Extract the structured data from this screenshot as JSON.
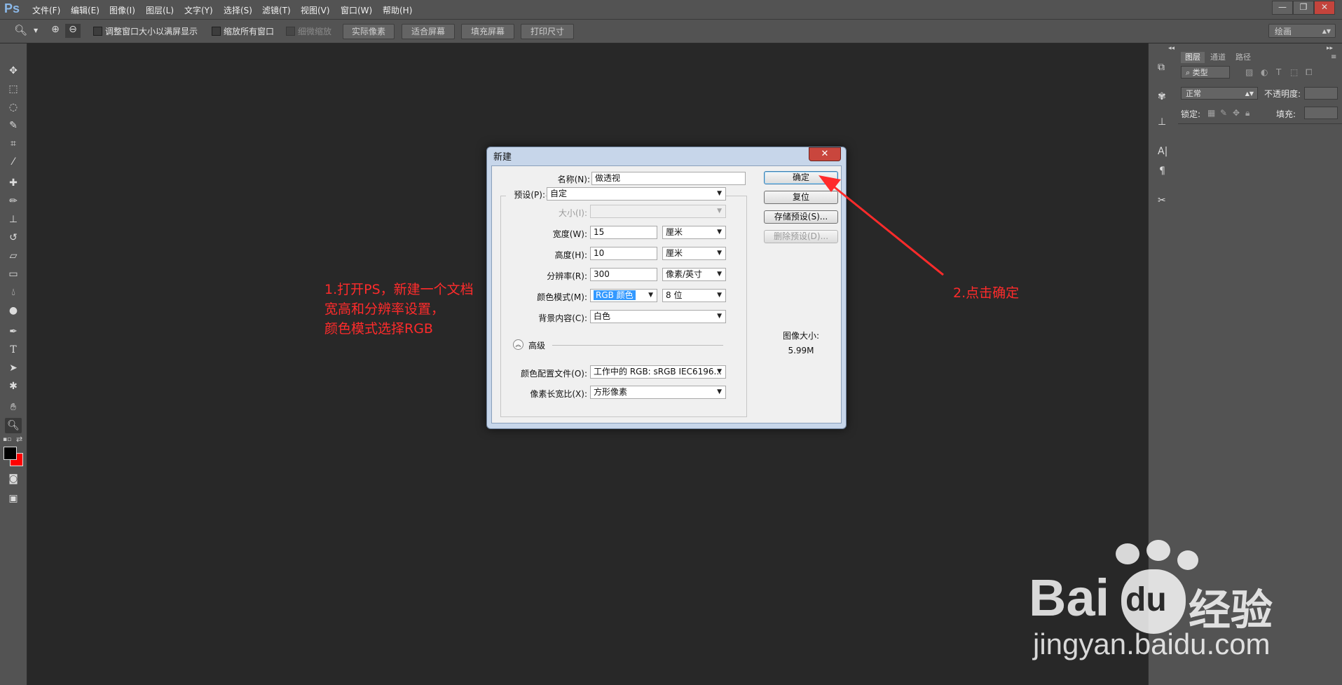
{
  "app": {
    "logo": "Ps"
  },
  "menu": [
    "文件(F)",
    "编辑(E)",
    "图像(I)",
    "图层(L)",
    "文字(Y)",
    "选择(S)",
    "滤镜(T)",
    "视图(V)",
    "窗口(W)",
    "帮助(H)"
  ],
  "window_controls": {
    "minimize": "—",
    "restore": "❐",
    "close": "✕"
  },
  "options_bar": {
    "zoom_icon": "zoom-icon",
    "checkbox_resize": "调整窗口大小以满屏显示",
    "checkbox_zoom_all": "缩放所有窗口",
    "checkbox_scrubby": "细微缩放",
    "btn_actual": "实际像素",
    "btn_fit": "适合屏幕",
    "btn_fill": "填充屏幕",
    "btn_print": "打印尺寸",
    "workspace": "绘画"
  },
  "tools": [
    "move-icon",
    "marquee-icon",
    "lasso-icon",
    "quick-select-icon",
    "crop-icon",
    "eyedropper-icon",
    "healing-icon",
    "brush-icon",
    "stamp-icon",
    "history-brush-icon",
    "eraser-icon",
    "gradient-icon",
    "blur-icon",
    "dodge-icon",
    "pen-icon",
    "type-icon",
    "path-select-icon",
    "shape-icon",
    "hand-icon",
    "zoom-icon"
  ],
  "colors": {
    "foreground": "#000000",
    "background": "#ff0000",
    "accent": "#ff2b2b"
  },
  "layers_panel": {
    "tabs": [
      "图层",
      "通道",
      "路径"
    ],
    "filter": "类型",
    "blend_mode": "正常",
    "opacity_label": "不透明度:",
    "lock_label": "锁定:",
    "fill_label": "填充:"
  },
  "dialog": {
    "title": "新建",
    "name_label": "名称(N):",
    "name_value": "做透视",
    "preset_label": "预设(P):",
    "preset_value": "自定",
    "size_label": "大小(I):",
    "width_label": "宽度(W):",
    "width_value": "15",
    "width_unit": "厘米",
    "height_label": "高度(H):",
    "height_value": "10",
    "height_unit": "厘米",
    "resolution_label": "分辨率(R):",
    "resolution_value": "300",
    "resolution_unit": "像素/英寸",
    "color_mode_label": "颜色模式(M):",
    "color_mode_value": "RGB 颜色",
    "bit_depth": "8 位",
    "bg_label": "背景内容(C):",
    "bg_value": "白色",
    "advanced_label": "高级",
    "profile_label": "颜色配置文件(O):",
    "profile_value": "工作中的 RGB: sRGB IEC6196...",
    "aspect_label": "像素长宽比(X):",
    "aspect_value": "方形像素",
    "ok": "确定",
    "reset": "复位",
    "save_preset": "存储预设(S)...",
    "delete_preset": "删除预设(D)...",
    "image_size_label": "图像大小:",
    "image_size_value": "5.99M"
  },
  "annotations": {
    "step1_line1": "1.打开PS，新建一个文档",
    "step1_line2": "宽高和分辨率设置，",
    "step1_line3": "颜色模式选择RGB",
    "step2": "2.点击确定"
  },
  "watermark": {
    "brand": "Bai",
    "brand2": "du",
    "product": "经验",
    "url": "jingyan.baidu.com"
  }
}
